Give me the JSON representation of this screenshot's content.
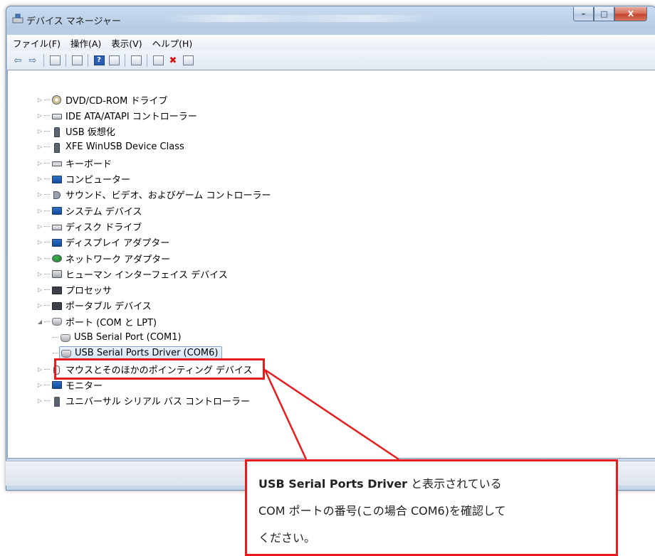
{
  "window": {
    "title": "デバイス マネージャー",
    "caption_minimize": "–",
    "caption_maximize": "□",
    "caption_close": "X"
  },
  "menu": [
    "ファイル(F)",
    "操作(A)",
    "表示(V)",
    "ヘルプ(H)"
  ],
  "toolbar_icons": [
    "back-arrow-icon",
    "forward-arrow-icon",
    "properties-icon",
    "view-icon",
    "help-icon",
    "view-icon-2",
    "scan-icon",
    "update-driver-icon",
    "uninstall-icon",
    "enable-icon"
  ],
  "tree": {
    "items": [
      {
        "label": "DVD/CD-ROM ドライブ",
        "icon": "disc"
      },
      {
        "label": "IDE ATA/ATAPI コントローラー",
        "icon": "drive"
      },
      {
        "label": "USB 仮想化",
        "icon": "usb"
      },
      {
        "label": "XFE WinUSB Device Class",
        "icon": "usb"
      },
      {
        "label": "キーボード",
        "icon": "kbd"
      },
      {
        "label": "コンピューター",
        "icon": "monitor"
      },
      {
        "label": "サウンド、ビデオ、およびゲーム コントローラー",
        "icon": "speaker"
      },
      {
        "label": "システム デバイス",
        "icon": "monitor"
      },
      {
        "label": "ディスク ドライブ",
        "icon": "drive"
      },
      {
        "label": "ディスプレイ アダプター",
        "icon": "monitor"
      },
      {
        "label": "ネットワーク アダプター",
        "icon": "net"
      },
      {
        "label": "ヒューマン インターフェイス デバイス",
        "icon": "hid"
      },
      {
        "label": "プロセッサ",
        "icon": "chip"
      },
      {
        "label": "ポータブル デバイス",
        "icon": "chip"
      },
      {
        "label": "ポート (COM と LPT)",
        "icon": "port",
        "expanded": true
      },
      {
        "label": "USB Serial Port (COM1)",
        "icon": "port",
        "child": true
      },
      {
        "label": "USB Serial Ports Driver (COM6)",
        "icon": "port",
        "child": true,
        "selected": true
      },
      {
        "label": "マウスとそのほかのポインティング デバイス",
        "icon": "mouse"
      },
      {
        "label": "モニター",
        "icon": "monitor"
      },
      {
        "label": "ユニバーサル シリアル バス コントローラー",
        "icon": "ubus"
      }
    ]
  },
  "callout": {
    "bold": "USB Serial Ports Driver",
    "line1_rest": " と表示されている",
    "line2": "COM ポートの番号(この場合 COM6)を確認して",
    "line3": "ください。"
  },
  "colors": {
    "highlight": "#e81c1c",
    "selection": "#d3e4f8"
  }
}
